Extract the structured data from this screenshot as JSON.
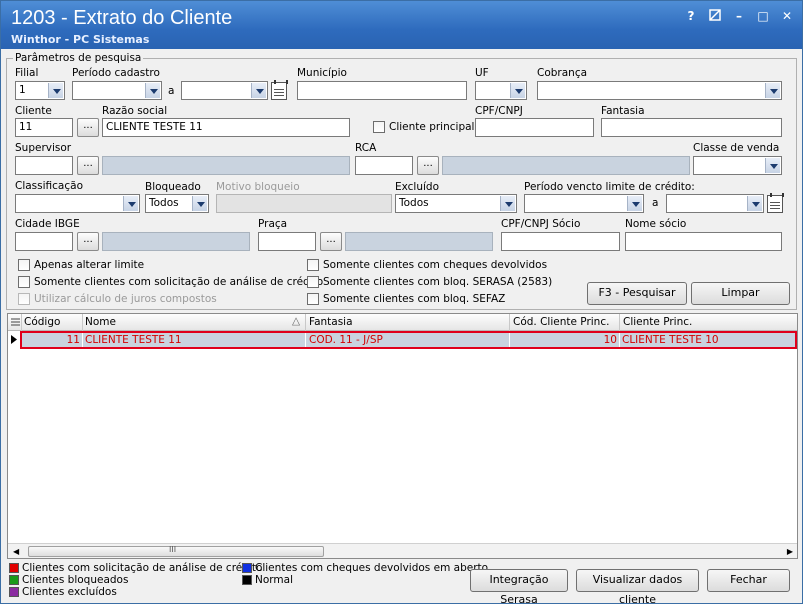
{
  "window": {
    "title": "1203 - Extrato do Cliente",
    "subtitle": "Winthor - PC Sistemas"
  },
  "titlebar_buttons": {
    "help": "?",
    "restore_icon": "restore-icon",
    "minimize": "–",
    "maximize": "□",
    "close": "✕"
  },
  "params": {
    "group_label": "Parâmetros de pesquisa",
    "filial_label": "Filial",
    "filial_value": "1",
    "periodo_label": "Período cadastro",
    "a1": "a",
    "municipio_label": "Município",
    "uf_label": "UF",
    "cobranca_label": "Cobrança",
    "cliente_label": "Cliente",
    "cliente_value": "11",
    "razao_label": "Razão social",
    "razao_value": "CLIENTE TESTE 11",
    "cliente_principal_label": "Cliente principal",
    "cpf_label": "CPF/CNPJ",
    "fantasia_label": "Fantasia",
    "supervisor_label": "Supervisor",
    "rca_label": "RCA",
    "classe_venda_label": "Classe de venda",
    "classificacao_label": "Classificação",
    "bloqueado_label": "Bloqueado",
    "bloqueado_value": "Todos",
    "motivo_label": "Motivo bloqueio",
    "excluido_label": "Excluído",
    "excluido_value": "Todos",
    "periodo_vencto_label": "Período vencto limite de crédito:",
    "a2": "a",
    "cidade_label": "Cidade IBGE",
    "praca_label": "Praça",
    "cpf_socio_label": "CPF/CNPJ Sócio",
    "nome_socio_label": "Nome sócio",
    "dots": "...",
    "chk_apenas": "Apenas alterar limite",
    "chk_solicitacao": "Somente clientes com solicitação de análise de crédito",
    "chk_juros": "Utilizar cálculo de juros compostos",
    "chk_cheques": "Somente clientes com cheques devolvidos",
    "chk_serasa": "Somente clientes com bloq. SERASA (2583)",
    "chk_sefaz": "Somente clientes com bloq. SEFAZ",
    "btn_pesquisar": "F3 - Pesquisar",
    "btn_limpar": "Limpar"
  },
  "grid": {
    "columns": [
      "Código",
      "Nome",
      "Fantasia",
      "Cód. Cliente Princ.",
      "Cliente Princ."
    ],
    "rows": [
      {
        "codigo": "11",
        "nome": "CLIENTE TESTE 11",
        "fantasia": "COD. 11 - J/SP",
        "cod_princ": "10",
        "cliente_princ": "CLIENTE TESTE 10"
      }
    ],
    "scroll_grip": "III"
  },
  "legend": {
    "solicitacao": "Clientes com solicitação de análise de crédito",
    "bloqueados": "Clientes bloqueados",
    "excluidos": "Clientes excluídos",
    "cheques": "Clientes com cheques devolvidos em aberto",
    "normal": "Normal",
    "colors": {
      "solicitacao": "#e00000",
      "bloqueados": "#1a9a1a",
      "excluidos": "#8a2ba0",
      "cheques": "#1030e0",
      "normal": "#000000"
    }
  },
  "footer": {
    "btn_serasa": "Integração Serasa",
    "btn_visualizar": "Visualizar dados cliente",
    "btn_fechar": "Fechar"
  }
}
